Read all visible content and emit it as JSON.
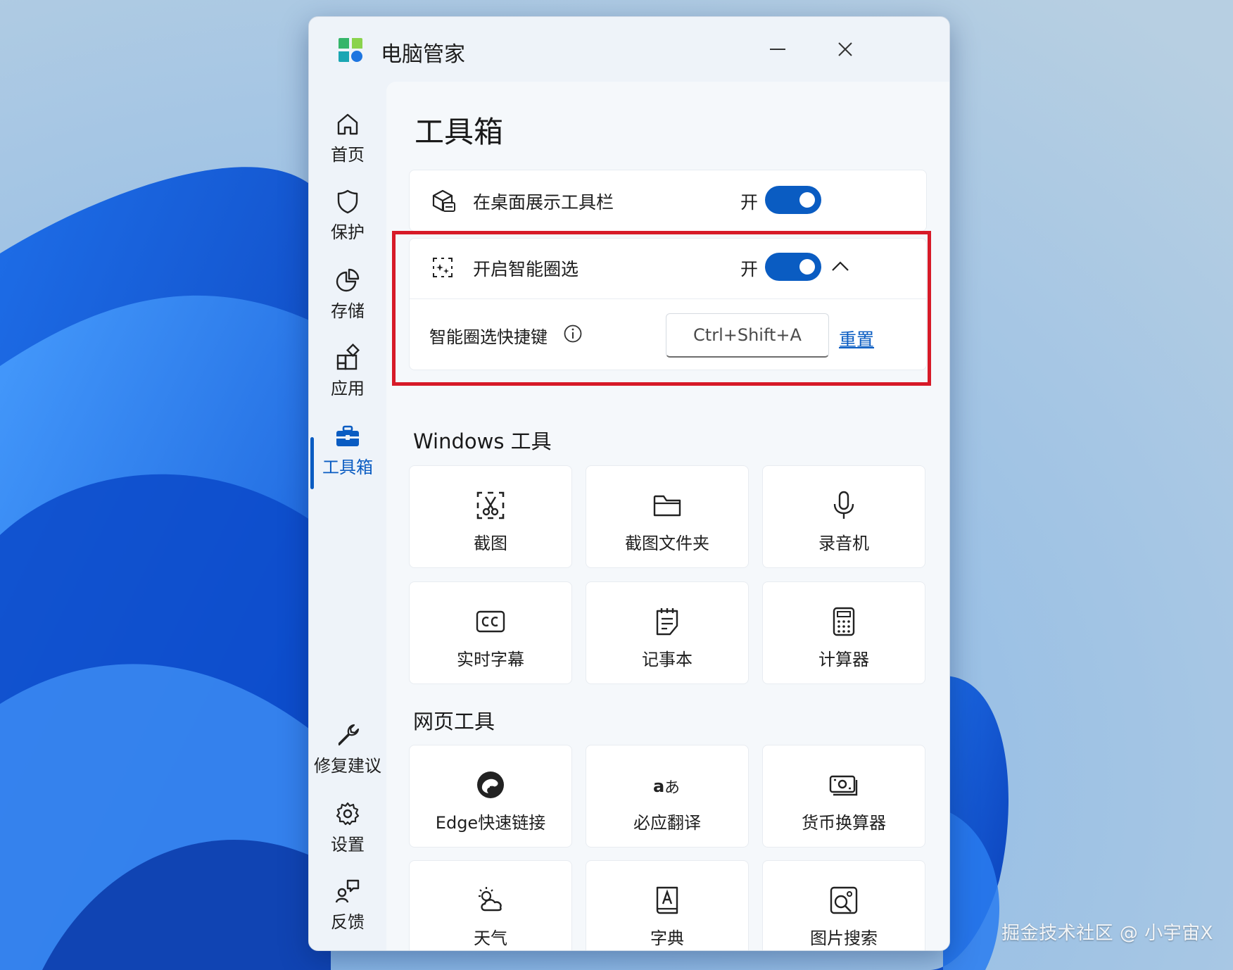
{
  "window": {
    "title": "电脑管家"
  },
  "sidebar": {
    "items": [
      {
        "label": "首页",
        "icon": "home-icon",
        "active": false
      },
      {
        "label": "保护",
        "icon": "shield-icon",
        "active": false
      },
      {
        "label": "存储",
        "icon": "pie-chart-icon",
        "active": false
      },
      {
        "label": "应用",
        "icon": "apps-icon",
        "active": false
      },
      {
        "label": "工具箱",
        "icon": "toolbox-icon",
        "active": true
      }
    ],
    "bottom_items": [
      {
        "label": "修复建议",
        "icon": "wrench-icon"
      },
      {
        "label": "设置",
        "icon": "gear-icon"
      },
      {
        "label": "反馈",
        "icon": "feedback-icon"
      }
    ]
  },
  "page": {
    "title": "工具箱",
    "desktop_toolbar": {
      "label": "在桌面展示工具栏",
      "state_text": "开",
      "on": true
    },
    "smart_select": {
      "label": "开启智能圈选",
      "state_text": "开",
      "on": true,
      "expanded": true,
      "shortcut_label": "智能圈选快捷键",
      "shortcut_value": "Ctrl+Shift+A",
      "reset_label": "重置"
    },
    "windows_tools": {
      "title": "Windows 工具",
      "items": [
        {
          "label": "截图",
          "icon": "snipping-icon"
        },
        {
          "label": "截图文件夹",
          "icon": "folder-icon"
        },
        {
          "label": "录音机",
          "icon": "microphone-icon"
        },
        {
          "label": "实时字幕",
          "icon": "captions-icon"
        },
        {
          "label": "记事本",
          "icon": "notepad-icon"
        },
        {
          "label": "计算器",
          "icon": "calculator-icon"
        }
      ]
    },
    "web_tools": {
      "title": "网页工具",
      "items": [
        {
          "label": "Edge快速链接",
          "icon": "edge-icon"
        },
        {
          "label": "必应翻译",
          "icon": "translate-icon"
        },
        {
          "label": "货币换算器",
          "icon": "currency-icon"
        },
        {
          "label": "天气",
          "icon": "weather-icon"
        },
        {
          "label": "字典",
          "icon": "dictionary-icon"
        },
        {
          "label": "图片搜索",
          "icon": "image-search-icon"
        }
      ]
    }
  },
  "watermark": "掘金技术社区 @ 小宇宙X",
  "colors": {
    "accent": "#0a5cc2",
    "highlight": "#d71a28"
  }
}
